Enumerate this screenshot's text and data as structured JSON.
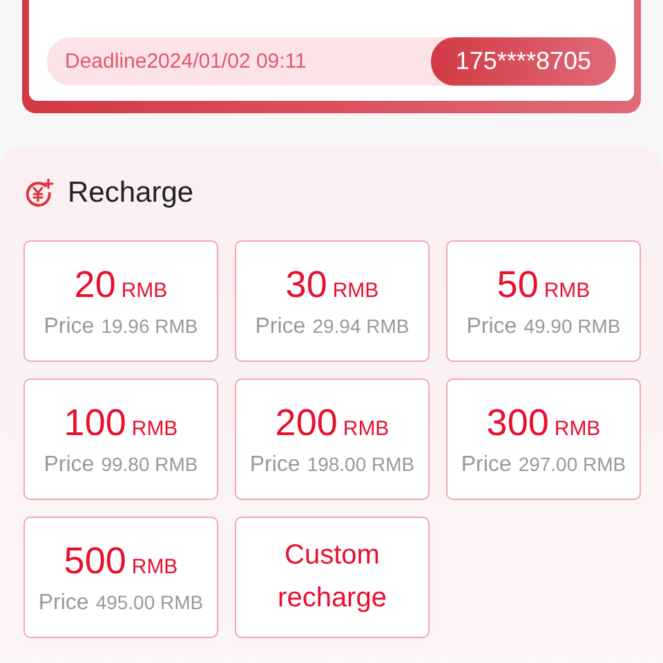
{
  "membership_card": {
    "deadline": "Deadline2024/01/02 09:11",
    "phone": "175****8705"
  },
  "recharge": {
    "title": "Recharge",
    "options": [
      {
        "kind": "amount",
        "value": "20",
        "unit": "RMB",
        "price_label": "Price",
        "price": "19.96 RMB"
      },
      {
        "kind": "amount",
        "value": "30",
        "unit": "RMB",
        "price_label": "Price",
        "price": "29.94 RMB"
      },
      {
        "kind": "amount",
        "value": "50",
        "unit": "RMB",
        "price_label": "Price",
        "price": "49.90 RMB"
      },
      {
        "kind": "amount",
        "value": "100",
        "unit": "RMB",
        "price_label": "Price",
        "price": "99.80 RMB"
      },
      {
        "kind": "amount",
        "value": "200",
        "unit": "RMB",
        "price_label": "Price",
        "price": "198.00 RMB"
      },
      {
        "kind": "amount",
        "value": "300",
        "unit": "RMB",
        "price_label": "Price",
        "price": "297.00 RMB"
      },
      {
        "kind": "amount",
        "value": "500",
        "unit": "RMB",
        "price_label": "Price",
        "price": "495.00 RMB"
      },
      {
        "kind": "custom",
        "label": "Custom recharge"
      }
    ]
  }
}
